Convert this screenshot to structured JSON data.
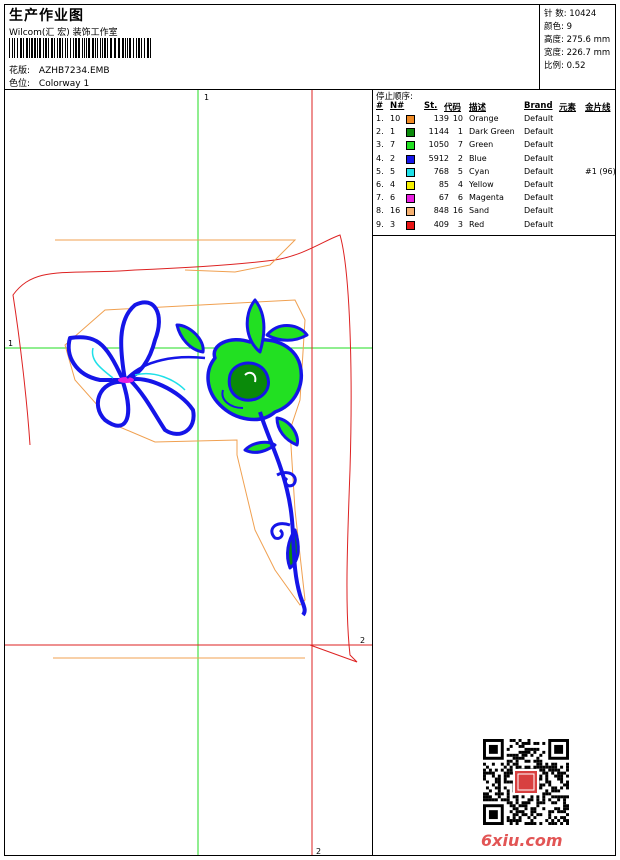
{
  "header": {
    "title": "生产作业图",
    "software": "Wilcom(汇 宏) 装饰工作室",
    "design_label": "花版:",
    "design_value": "AZHB7234.EMB",
    "colorway_label": "色位:",
    "colorway_value": "Colorway 1"
  },
  "info": {
    "stitches_label": "针 数:",
    "stitches_value": "10424",
    "colors_label": "颜色:",
    "colors_value": "9",
    "height_label": "高度:",
    "height_value": "275.6 mm",
    "width_label": "宽度:",
    "width_value": "226.7 mm",
    "scale_label": "比例:",
    "scale_value": "0.52"
  },
  "stop_sequence": {
    "title": "停止顺序:",
    "headers": {
      "num": "#",
      "n": "N#",
      "st": "St.",
      "code": "代码",
      "desc": "描述",
      "brand": "Brand",
      "element": "元素",
      "sequin": "金片线"
    },
    "rows": [
      {
        "num": "1.",
        "n": "10",
        "color": "#f08a24",
        "st": "139",
        "code": "10",
        "desc": "Orange",
        "brand": "Default",
        "sequin": ""
      },
      {
        "num": "2.",
        "n": "1",
        "color": "#0a8a0a",
        "st": "1144",
        "code": "1",
        "desc": "Dark Green",
        "brand": "Default",
        "sequin": ""
      },
      {
        "num": "3.",
        "n": "7",
        "color": "#22e022",
        "st": "1050",
        "code": "7",
        "desc": "Green",
        "brand": "Default",
        "sequin": ""
      },
      {
        "num": "4.",
        "n": "2",
        "color": "#1515e8",
        "st": "5912",
        "code": "2",
        "desc": "Blue",
        "brand": "Default",
        "sequin": ""
      },
      {
        "num": "5.",
        "n": "5",
        "color": "#1ee0e8",
        "st": "768",
        "code": "5",
        "desc": "Cyan",
        "brand": "Default",
        "sequin": "#1 (96)"
      },
      {
        "num": "6.",
        "n": "4",
        "color": "#f5f000",
        "st": "85",
        "code": "4",
        "desc": "Yellow",
        "brand": "Default",
        "sequin": ""
      },
      {
        "num": "7.",
        "n": "6",
        "color": "#e81ee0",
        "st": "67",
        "code": "6",
        "desc": "Magenta",
        "brand": "Default",
        "sequin": ""
      },
      {
        "num": "8.",
        "n": "16",
        "color": "#f5b070",
        "st": "848",
        "code": "16",
        "desc": "Sand",
        "brand": "Default",
        "sequin": ""
      },
      {
        "num": "9.",
        "n": "3",
        "color": "#e81515",
        "st": "409",
        "code": "3",
        "desc": "Red",
        "brand": "Default",
        "sequin": ""
      }
    ]
  },
  "guides": {
    "green_v": "1",
    "green_h": "1",
    "red_h": "2",
    "red_v": "2"
  },
  "watermark": {
    "site": "6xiu.com"
  },
  "colors": {
    "guide_green": "#22dd22",
    "guide_red": "#dd2222",
    "outline_orange": "#f0a050",
    "blue": "#1515e8"
  }
}
